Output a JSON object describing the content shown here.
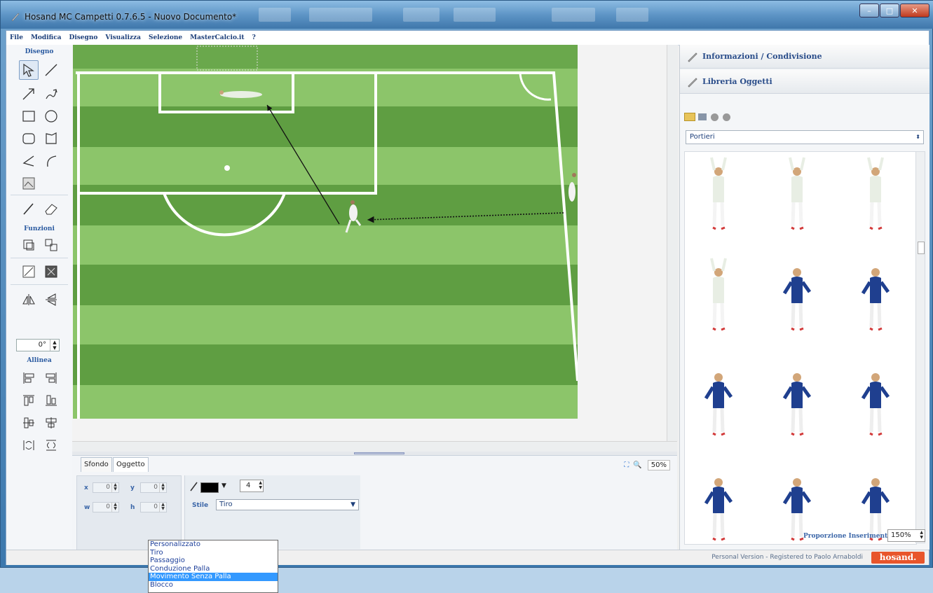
{
  "window": {
    "title": "Hosand MC Campetti 0.7.6.5 - Nuovo Documento*"
  },
  "menu": [
    "File",
    "Modifica",
    "Disegno",
    "Visualizza",
    "Selezione",
    "MasterCalcio.it",
    "?"
  ],
  "toolbox": {
    "section_draw": "Disegno",
    "section_functions": "Funzioni",
    "section_align": "Allinea",
    "rotation_value": "0°"
  },
  "bottom_panel": {
    "tabs": [
      "Sfondo",
      "Oggetto"
    ],
    "zoom": "50%",
    "fields": {
      "x_label": "x",
      "x_value": "0",
      "y_label": "y",
      "y_value": "0",
      "w_label": "w",
      "w_value": "0",
      "h_label": "h",
      "h_value": "0"
    },
    "line_color": "#000000",
    "line_width": "4",
    "style_label": "Stile",
    "style_selected": "Tiro",
    "style_options": [
      "Personalizzato",
      "Tiro",
      "Passaggio",
      "Conduzione Palla",
      "Movimento Senza Palla",
      "Blocco"
    ],
    "style_highlighted": "Movimento Senza Palla"
  },
  "right_panel": {
    "info_header": "Informazioni / Condivisione",
    "library_header": "Libreria Oggetti",
    "category": "Portieri",
    "insert_label": "Proporzione Inserimento :",
    "insert_value": "150%"
  },
  "status": {
    "text": "Personal Version - Registered to Paolo Arnaboldi",
    "logo": "hosand."
  },
  "colors": {
    "pitch_light": "#8cc56a",
    "pitch_dark": "#5f9e42",
    "goalkeeper_kit": "#1f3f8f",
    "accent": "#3399ff",
    "brand": "#e8552b"
  }
}
